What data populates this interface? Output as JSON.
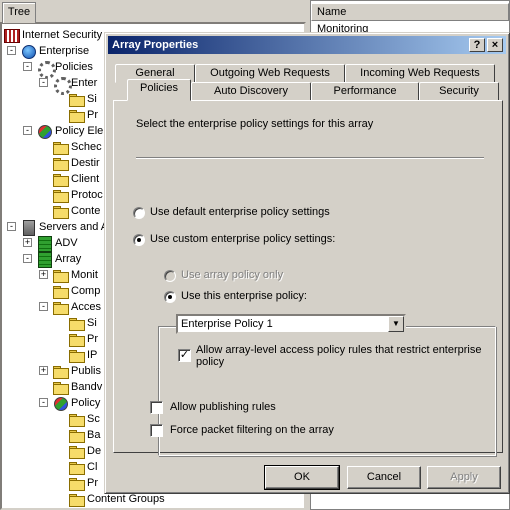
{
  "mmc": {
    "tree_tab": "Tree",
    "name_header": "Name",
    "right_first_item": "Monitoring",
    "tree": [
      {
        "label": "Internet Security",
        "icon": "isa-icon",
        "expander": ""
      },
      {
        "label": "Enterprise",
        "icon": "globe-icon",
        "expander": "-"
      },
      {
        "label": "Policies",
        "icon": "gear-icon",
        "expander": "-"
      },
      {
        "label": "Enter",
        "icon": "gear-icon",
        "expander": "-"
      },
      {
        "label": "Si",
        "icon": "folder-icon",
        "expander": ""
      },
      {
        "label": "Pr",
        "icon": "folder-icon",
        "expander": ""
      },
      {
        "label": "Policy Ele",
        "icon": "policy-icon",
        "expander": "-"
      },
      {
        "label": "Schec",
        "icon": "folder-icon",
        "expander": ""
      },
      {
        "label": "Destir",
        "icon": "folder-icon",
        "expander": ""
      },
      {
        "label": "Client",
        "icon": "folder-icon",
        "expander": ""
      },
      {
        "label": "Protoc",
        "icon": "folder-icon",
        "expander": ""
      },
      {
        "label": "Conte",
        "icon": "folder-icon",
        "expander": ""
      },
      {
        "label": "Servers and A",
        "icon": "server-icon",
        "expander": "-"
      },
      {
        "label": "ADV",
        "icon": "array-icon",
        "expander": "+"
      },
      {
        "label": "Array",
        "icon": "array-icon",
        "expander": "-"
      },
      {
        "label": "Monit",
        "icon": "folder-icon",
        "expander": "+"
      },
      {
        "label": "Comp",
        "icon": "folder-icon",
        "expander": ""
      },
      {
        "label": "Acces",
        "icon": "folder-icon",
        "expander": "-"
      },
      {
        "label": "Si",
        "icon": "folder-icon",
        "expander": ""
      },
      {
        "label": "Pr",
        "icon": "folder-icon",
        "expander": ""
      },
      {
        "label": "IP",
        "icon": "folder-icon",
        "expander": ""
      },
      {
        "label": "Publis",
        "icon": "folder-icon",
        "expander": "+"
      },
      {
        "label": "Bandv",
        "icon": "folder-icon",
        "expander": ""
      },
      {
        "label": "Policy",
        "icon": "policy-icon",
        "expander": "-"
      },
      {
        "label": "Sc",
        "icon": "folder-icon",
        "expander": ""
      },
      {
        "label": "Ba",
        "icon": "folder-icon",
        "expander": ""
      },
      {
        "label": "De",
        "icon": "folder-icon",
        "expander": ""
      },
      {
        "label": "Cl",
        "icon": "folder-icon",
        "expander": ""
      },
      {
        "label": "Pr",
        "icon": "folder-icon",
        "expander": ""
      },
      {
        "label": "Content Groups",
        "icon": "folder-icon",
        "expander": ""
      }
    ]
  },
  "dialog": {
    "title": "Array Properties",
    "help_button": "?",
    "close_button": "×",
    "tabs_back": [
      "General",
      "Outgoing Web Requests",
      "Incoming Web Requests"
    ],
    "tabs_front": [
      "Policies",
      "Auto Discovery",
      "Performance",
      "Security"
    ],
    "active_tab": "Policies",
    "description": "Select the enterprise policy settings for this array",
    "radio_default": "Use default enterprise policy settings",
    "radio_custom": "Use custom enterprise policy settings:",
    "radio_array_only": "Use array policy only",
    "radio_this_policy": "Use this enterprise policy:",
    "policy_selected": "Enterprise Policy 1",
    "allow_array_rules": "Allow array-level access policy rules that restrict enterprise policy",
    "allow_publishing": "Allow publishing rules",
    "force_packet": "Force packet filtering on the array",
    "ok": "OK",
    "cancel": "Cancel",
    "apply": "Apply"
  }
}
